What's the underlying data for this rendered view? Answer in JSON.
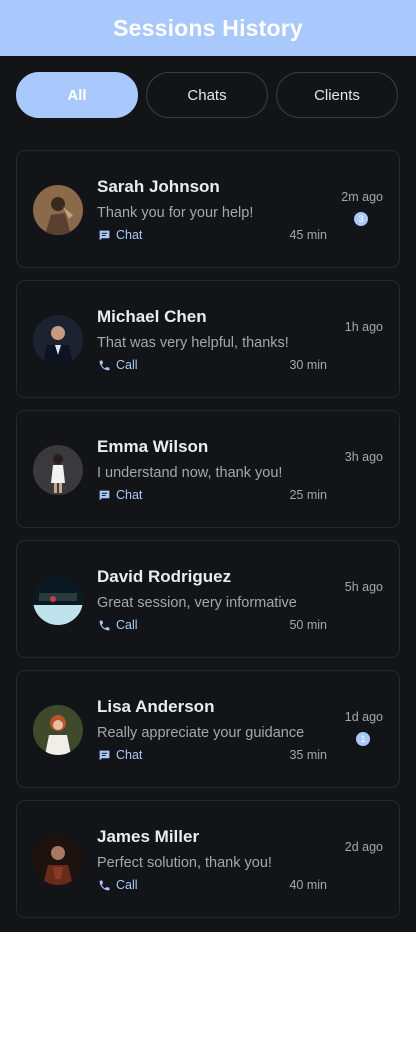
{
  "header": {
    "title": "Sessions History"
  },
  "tabs": [
    {
      "label": "All",
      "active": true
    },
    {
      "label": "Chats",
      "active": false
    },
    {
      "label": "Clients",
      "active": false
    }
  ],
  "sessions": [
    {
      "name": "Sarah Johnson",
      "message": "Thank you for your help!",
      "type": "Chat",
      "type_icon": "chat-icon",
      "duration": "45 min",
      "time": "2m ago",
      "unread": "3"
    },
    {
      "name": "Michael Chen",
      "message": "That was very helpful, thanks!",
      "type": "Call",
      "type_icon": "phone-icon",
      "duration": "30 min",
      "time": "1h ago",
      "unread": ""
    },
    {
      "name": "Emma Wilson",
      "message": "I understand now, thank you!",
      "type": "Chat",
      "type_icon": "chat-icon",
      "duration": "25 min",
      "time": "3h ago",
      "unread": ""
    },
    {
      "name": "David Rodriguez",
      "message": "Great session, very informative",
      "type": "Call",
      "type_icon": "phone-icon",
      "duration": "50 min",
      "time": "5h ago",
      "unread": ""
    },
    {
      "name": "Lisa Anderson",
      "message": "Really appreciate your guidance",
      "type": "Chat",
      "type_icon": "chat-icon",
      "duration": "35 min",
      "time": "1d ago",
      "unread": "1"
    },
    {
      "name": "James Miller",
      "message": "Perfect solution, thank you!",
      "type": "Call",
      "type_icon": "phone-icon",
      "duration": "40 min",
      "time": "2d ago",
      "unread": ""
    }
  ],
  "colors": {
    "accent": "#a9c8fb",
    "background": "#131418",
    "card_border": "#26282e",
    "text_primary": "#ebecef",
    "text_secondary": "#a4a7ae"
  }
}
